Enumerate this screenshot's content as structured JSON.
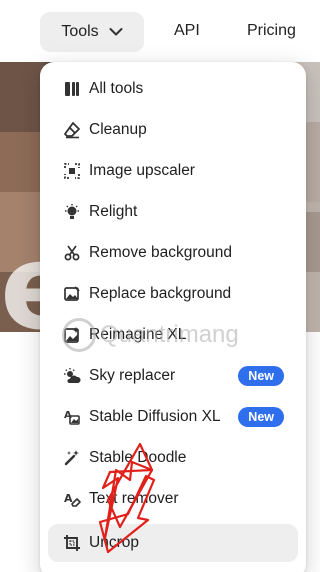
{
  "nav": {
    "tools_label": "Tools",
    "api_label": "API",
    "pricing_label": "Pricing"
  },
  "menu": {
    "items": [
      {
        "label": "All tools",
        "icon": "grid-tools-icon"
      },
      {
        "label": "Cleanup",
        "icon": "eraser-icon"
      },
      {
        "label": "Image upscaler",
        "icon": "upscale-icon"
      },
      {
        "label": "Relight",
        "icon": "bulb-icon"
      },
      {
        "label": "Remove background",
        "icon": "scissors-icon"
      },
      {
        "label": "Replace background",
        "icon": "image-edit-icon"
      },
      {
        "label": "Reimagine XL",
        "icon": "image-sparkle-icon"
      },
      {
        "label": "Sky replacer",
        "icon": "sun-cloud-icon",
        "badge": "New"
      },
      {
        "label": "Stable Diffusion XL",
        "icon": "text-image-icon",
        "badge": "New"
      },
      {
        "label": "Stable Doodle",
        "icon": "magic-wand-icon"
      },
      {
        "label": "Text remover",
        "icon": "text-erase-icon"
      },
      {
        "label": "Uncrop",
        "icon": "crop-icon"
      }
    ]
  },
  "hero": {
    "letter": "e"
  },
  "watermark": {
    "text": "Quantrimang"
  },
  "colors": {
    "badge": "#2f6fed",
    "active_item": "#eeeeef",
    "arrow": "#e0201b"
  }
}
